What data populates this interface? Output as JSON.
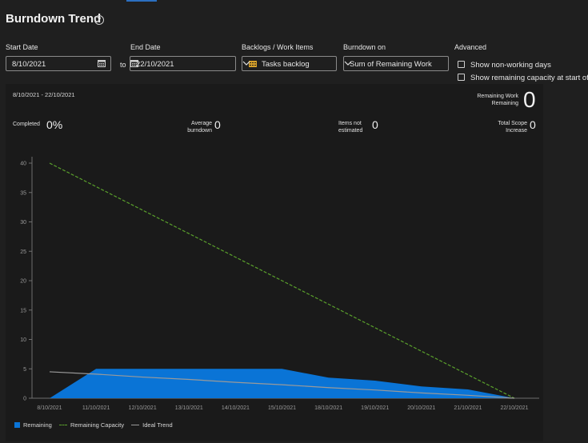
{
  "header": {
    "title": "Burndown Trend",
    "help_icon": "help-circle-icon"
  },
  "filters": {
    "start_date": {
      "label": "Start Date",
      "value": "8/10/2021"
    },
    "to_label": "to",
    "end_date": {
      "label": "End Date",
      "value": "22/10/2021"
    },
    "backlogs": {
      "label": "Backlogs / Work Items",
      "value": "Tasks backlog"
    },
    "burndown_on": {
      "label": "Burndown on",
      "value": "Sum of Remaining Work"
    },
    "advanced": {
      "label": "Advanced",
      "options": [
        {
          "label": "Show non-working days",
          "checked": false
        },
        {
          "label": "Show remaining capacity at start of",
          "checked": false
        }
      ]
    }
  },
  "summary": {
    "date_range": "8/10/2021 - 22/10/2021",
    "remaining_work": {
      "label_line1": "Remaining Work",
      "label_line2": "Remaining",
      "value": "0"
    },
    "completed": {
      "label": "Completed",
      "value": "0%"
    },
    "average_burndown": {
      "label_line1": "Average",
      "label_line2": "burndown",
      "value": "0"
    },
    "items_not_estimated": {
      "label_line1": "Items not",
      "label_line2": "estimated",
      "value": "0"
    },
    "total_scope_increase": {
      "label_line1": "Total Scope",
      "label_line2": "Increase",
      "value": "0"
    }
  },
  "colors": {
    "remaining": "#0a74d6",
    "capacity": "#5aa02c",
    "ideal": "#9a9a9a"
  },
  "chart_data": {
    "type": "area",
    "x": [
      "8/10/2021",
      "11/10/2021",
      "12/10/2021",
      "13/10/2021",
      "14/10/2021",
      "15/10/2021",
      "18/10/2021",
      "19/10/2021",
      "20/10/2021",
      "21/10/2021",
      "22/10/2021"
    ],
    "yticks": [
      0,
      5,
      10,
      15,
      20,
      25,
      30,
      35,
      40
    ],
    "ylim": [
      0,
      42
    ],
    "grid": false,
    "legend_position": "bottom-left",
    "series": [
      {
        "name": "Remaining",
        "kind": "area",
        "values": [
          0,
          5,
          5,
          5,
          5,
          5,
          3.5,
          3,
          2,
          1.5,
          0
        ]
      },
      {
        "name": "Remaining Capacity",
        "kind": "dashed-line",
        "values": [
          40,
          36,
          32,
          28,
          24,
          20,
          16,
          12,
          8,
          4,
          0
        ]
      },
      {
        "name": "Ideal Trend",
        "kind": "line",
        "values": [
          4.5,
          4.1,
          3.6,
          3.2,
          2.7,
          2.3,
          1.8,
          1.4,
          0.9,
          0.5,
          0
        ]
      }
    ]
  }
}
